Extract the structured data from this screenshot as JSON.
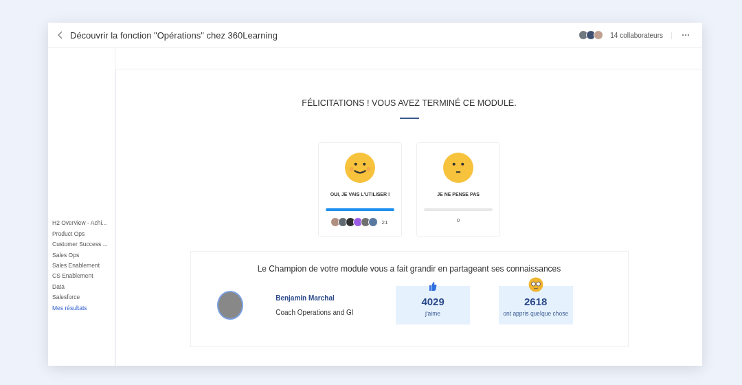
{
  "header": {
    "title": "Découvrir la fonction \"Opérations\" chez 360Learning",
    "collaborators": "14 collaborateurs"
  },
  "sidebar": {
    "items": [
      {
        "label": "H2 Overview - Achi...",
        "selected": false
      },
      {
        "label": "Product Ops",
        "selected": false
      },
      {
        "label": "Customer Success ...",
        "selected": false
      },
      {
        "label": "Sales Ops",
        "selected": false
      },
      {
        "label": "Sales Enablement",
        "selected": false
      },
      {
        "label": "CS Enablement",
        "selected": false
      },
      {
        "label": "Data",
        "selected": false
      },
      {
        "label": "Salesforce",
        "selected": false
      },
      {
        "label": "Mes résultats",
        "selected": true
      }
    ]
  },
  "heading": "FÉLICITATIONS ! VOUS AVEZ TERMINÉ CE MODULE.",
  "votes": [
    {
      "kind": "happy",
      "label": "OUI, JE VAIS L'UTILISER !",
      "level": 1,
      "count": "21"
    },
    {
      "kind": "unsure",
      "label": "JE NE PENSE PAS",
      "level": 0,
      "count": "0"
    }
  ],
  "champion": {
    "message": "Le Champion de votre module vous a fait grandir en partageant ses connaissances",
    "name": "Benjamin Marchal",
    "role": "Coach Operations and GI",
    "stats": [
      {
        "kind": "like",
        "value": "4029",
        "label": "j'aime"
      },
      {
        "kind": "learned",
        "value": "2618",
        "label": "ont appris quelque chose"
      }
    ]
  }
}
